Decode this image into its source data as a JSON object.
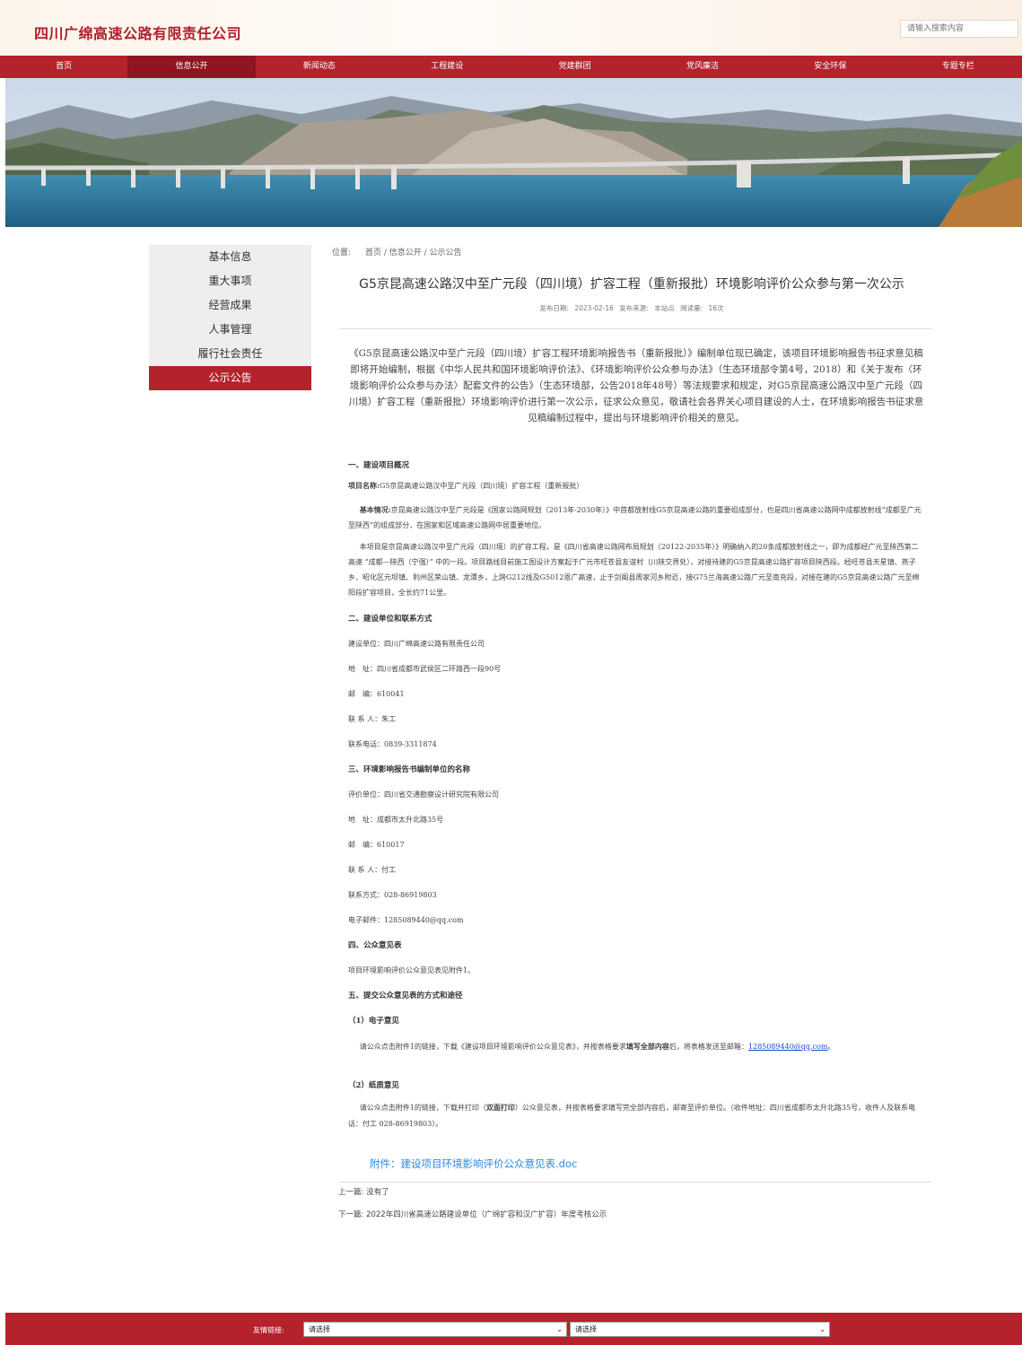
{
  "site": {
    "name": "四川广绵高速公路有限责任公司"
  },
  "search": {
    "placeholder": "请输入搜索内容"
  },
  "nav": [
    {
      "label": "首页"
    },
    {
      "label": "信息公开",
      "active": true
    },
    {
      "label": "新闻动态"
    },
    {
      "label": "工程建设"
    },
    {
      "label": "党建群团"
    },
    {
      "label": "党风廉洁"
    },
    {
      "label": "安全环保"
    },
    {
      "label": "专题专栏"
    }
  ],
  "sidebar": {
    "items": [
      {
        "label": "基本信息"
      },
      {
        "label": "重大事项"
      },
      {
        "label": "经营成果"
      },
      {
        "label": "人事管理"
      },
      {
        "label": "履行社会责任"
      },
      {
        "label": "公示公告",
        "active": true
      }
    ]
  },
  "breadcrumb": {
    "prefix": "位置:",
    "path": "首页 / 信息公开 / 公示公告"
  },
  "article": {
    "title": "G5京昆高速公路汉中至广元段（四川境）扩容工程（重新报批）环境影响评价公众参与第一次公示",
    "meta": "发布日期: 2023-02-16   发布来源: 本站点   阅读量: 16次",
    "intro": "《G5京昆高速公路汉中至广元段（四川境）扩容工程环境影响报告书（重新报批）》编制单位现已确定，该项目环境影响报告书征求意见稿即将开始编制，根据《中华人民共和国环境影响评价法》、《环境影响评价公众参与办法》（生态环境部令第4号，2018）和《关于发布〈环境影响评价公众参与办法〉配套文件的公告》（生态环境部，公告2018年48号）等法规要求和规定，对G5京昆高速公路汉中至广元段（四川境）扩容工程（重新报批）环境影响评价进行第一次公示，征求公众意见，敬请社会各界关心项目建设的人士，在环境影响报告书征求意见稿编制过程中，提出与环境影响评价相关的意见。",
    "s1": {
      "heading": "一、建设项目概况",
      "name_label": "项目名称:",
      "name_value": "G5京昆高速公路汉中至广元段（四川境）扩容工程（重新报批）",
      "basic_label": "基本情况:",
      "basic_value": "京昆高速公路汉中至广元段是《国家公路网规划（2013年-2030年）》中首都放射线G5京昆高速公路的重要组成部分，也是四川省高速公路网中成都放射线“成都至广元至陕西”的组成部分，在国家和区域高速公路网中居重要地位。",
      "para": "本项目是京昆高速公路汉中至广元段（四川境）的扩容工程，是《四川省高速公路网布局规划（20122-2035年）》明确纳入的20条成都放射线之一，即为成都经广元至陕西第二高速 “成都—陕西（宁强）” 中的一段。项目路线目前施工图设计方案起于广元市旺苍县友谊村（川陕交界处），对接待建的G5京昆高速公路扩容项目陕西段。经旺苍县天星镇、燕子乡、昭化区元坝镇、利州区荣山镇、龙潭乡，上跨G212线及G5012恩广高速，止于剑阁县周家河乡附近，接G75兰海高速公路广元至南充段，对接在建的G5京昆高速公路广元至绵阳段扩容项目，全长约71公里。"
    },
    "s2": {
      "heading": "二、建设单位和联系方式",
      "unit": "建设单位：四川广绵高速公路有限责任公司",
      "address": "地　址：四川省成都市武侯区二环路西一段90号",
      "postcode": "邮　编：610041",
      "contact": "联 系 人：朱工",
      "phone": "联系电话：0839-3311874"
    },
    "s3": {
      "heading": "三、环境影响报告书编制单位的名称",
      "unit": "评价单位：四川省交通勘察设计研究院有限公司",
      "address": "地　址：成都市太升北路35号",
      "postcode": "邮　编：610017",
      "contact": "联 系 人：付工",
      "phone": "联系方式：028-86919803",
      "email": "电子邮件：1285089440@qq.com"
    },
    "s4": {
      "heading": "四、公众意见表",
      "text": "项目环境影响评价公众意见表见附件1。"
    },
    "s5": {
      "heading": "五、提交公众意见表的方式和途径",
      "e_heading": "（1）电子意见",
      "e_text_1": "请公众点击附件1的链接，下载《建设项目环境影响评价公众意见表》，并按表格要求",
      "e_text_bold": "填写全部内容",
      "e_text_2": "后，将表格发送至邮箱：",
      "e_email": "1285089440@qq.com",
      "e_end": "。",
      "p_heading": "（2）纸质意见",
      "p_text_1": "请公众点击附件1的链接，下载并打印（",
      "p_text_bold": "双面打印",
      "p_text_2": "）公众意见表，并按表格要求填写完全部内容后，邮寄至评价单位。（收件地址：四川省成都市太升北路35号，收件人及联系电话：付工 028-86919803）。"
    },
    "attachment": "附件：建设项目环境影响评价公众意见表.doc"
  },
  "pager": {
    "prev_label": "上一篇:",
    "prev_value": "没有了",
    "next_label": "下一篇:",
    "next_value": "2022年四川省高速公路建设单位（广绵扩容和汉广扩容）年度考核公示"
  },
  "footer": {
    "links_label": "友情链接:",
    "select1": "请选择",
    "select2": "请选择"
  },
  "colors": {
    "brand_red": "#b4222c",
    "active_nav": "#8f1520",
    "link_blue": "#2b8be0"
  }
}
